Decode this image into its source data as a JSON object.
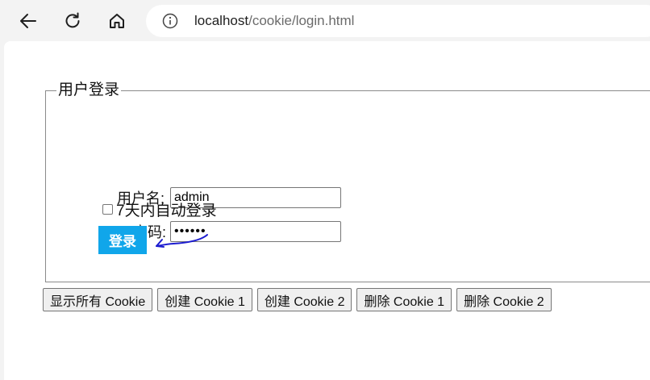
{
  "browser": {
    "url_host": "localhost",
    "url_path": "/cookie/login.html"
  },
  "form": {
    "legend": "用户登录",
    "username_label": "用户名:",
    "username_value": "admin",
    "password_label": "密码:",
    "password_value": "••••••",
    "remember_label": "7天内自动登录",
    "remember_checked": false,
    "login_label": "登录"
  },
  "cookie_buttons": [
    {
      "label": "显示所有 Cookie"
    },
    {
      "label": "创建 Cookie 1"
    },
    {
      "label": "创建 Cookie 2"
    },
    {
      "label": "删除 Cookie 1"
    },
    {
      "label": "删除 Cookie 2"
    }
  ],
  "colors": {
    "login_button": "#10a6ea",
    "annotation_arrow": "#1d1dd0"
  },
  "icons": [
    "back-arrow-icon",
    "reload-icon",
    "home-icon",
    "info-icon"
  ]
}
